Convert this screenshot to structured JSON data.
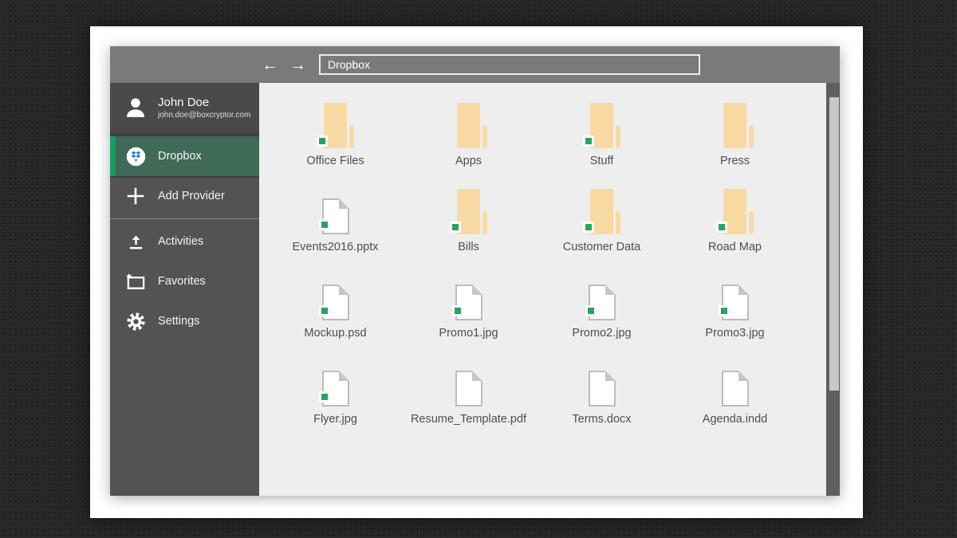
{
  "app": {
    "titlebar": {
      "back_icon": "←",
      "forward_icon": "→",
      "address": {
        "value": "Dropbox"
      }
    },
    "sidebar": {
      "user": {
        "name": "John Doe",
        "email": "john.doe@boxcryptor.com"
      },
      "items": [
        {
          "label": "Dropbox",
          "icon": "dropbox",
          "selected": true
        },
        {
          "label": "Add Provider",
          "icon": "plus",
          "selected": false
        },
        {
          "label": "Activities",
          "icon": "upload",
          "selected": false
        },
        {
          "label": "Favorites",
          "icon": "favorites",
          "selected": false
        },
        {
          "label": "Settings",
          "icon": "gear",
          "selected": false
        }
      ]
    },
    "files": [
      {
        "name": "Office Files",
        "type": "folder",
        "encrypted": true
      },
      {
        "name": "Apps",
        "type": "folder",
        "encrypted": false
      },
      {
        "name": "Stuff",
        "type": "folder",
        "encrypted": true
      },
      {
        "name": "Press",
        "type": "folder",
        "encrypted": false
      },
      {
        "name": "Events2016.pptx",
        "type": "file",
        "encrypted": true
      },
      {
        "name": "Bills",
        "type": "folder",
        "encrypted": true
      },
      {
        "name": "Customer Data",
        "type": "folder",
        "encrypted": true
      },
      {
        "name": "Road Map",
        "type": "folder",
        "encrypted": true
      },
      {
        "name": "Mockup.psd",
        "type": "file",
        "encrypted": true
      },
      {
        "name": "Promo1.jpg",
        "type": "file",
        "encrypted": true
      },
      {
        "name": "Promo2.jpg",
        "type": "file",
        "encrypted": true
      },
      {
        "name": "Promo3.jpg",
        "type": "file",
        "encrypted": true
      },
      {
        "name": "Flyer.jpg",
        "type": "file",
        "encrypted": true
      },
      {
        "name": "Resume_Template.pdf",
        "type": "file",
        "encrypted": false
      },
      {
        "name": "Terms.docx",
        "type": "file",
        "encrypted": false
      },
      {
        "name": "Agenda.indd",
        "type": "file",
        "encrypted": false
      }
    ],
    "colors": {
      "accent_green": "#3e6a57",
      "accent_stripe": "#169c60",
      "badge_green": "#27a55f",
      "folder_tan": "#f8d9a1",
      "dropbox_blue": "#1976d2",
      "topbar_gray": "#7a7a7a",
      "sidebar_gray": "#535353",
      "content_bg": "#eeeeee"
    }
  }
}
